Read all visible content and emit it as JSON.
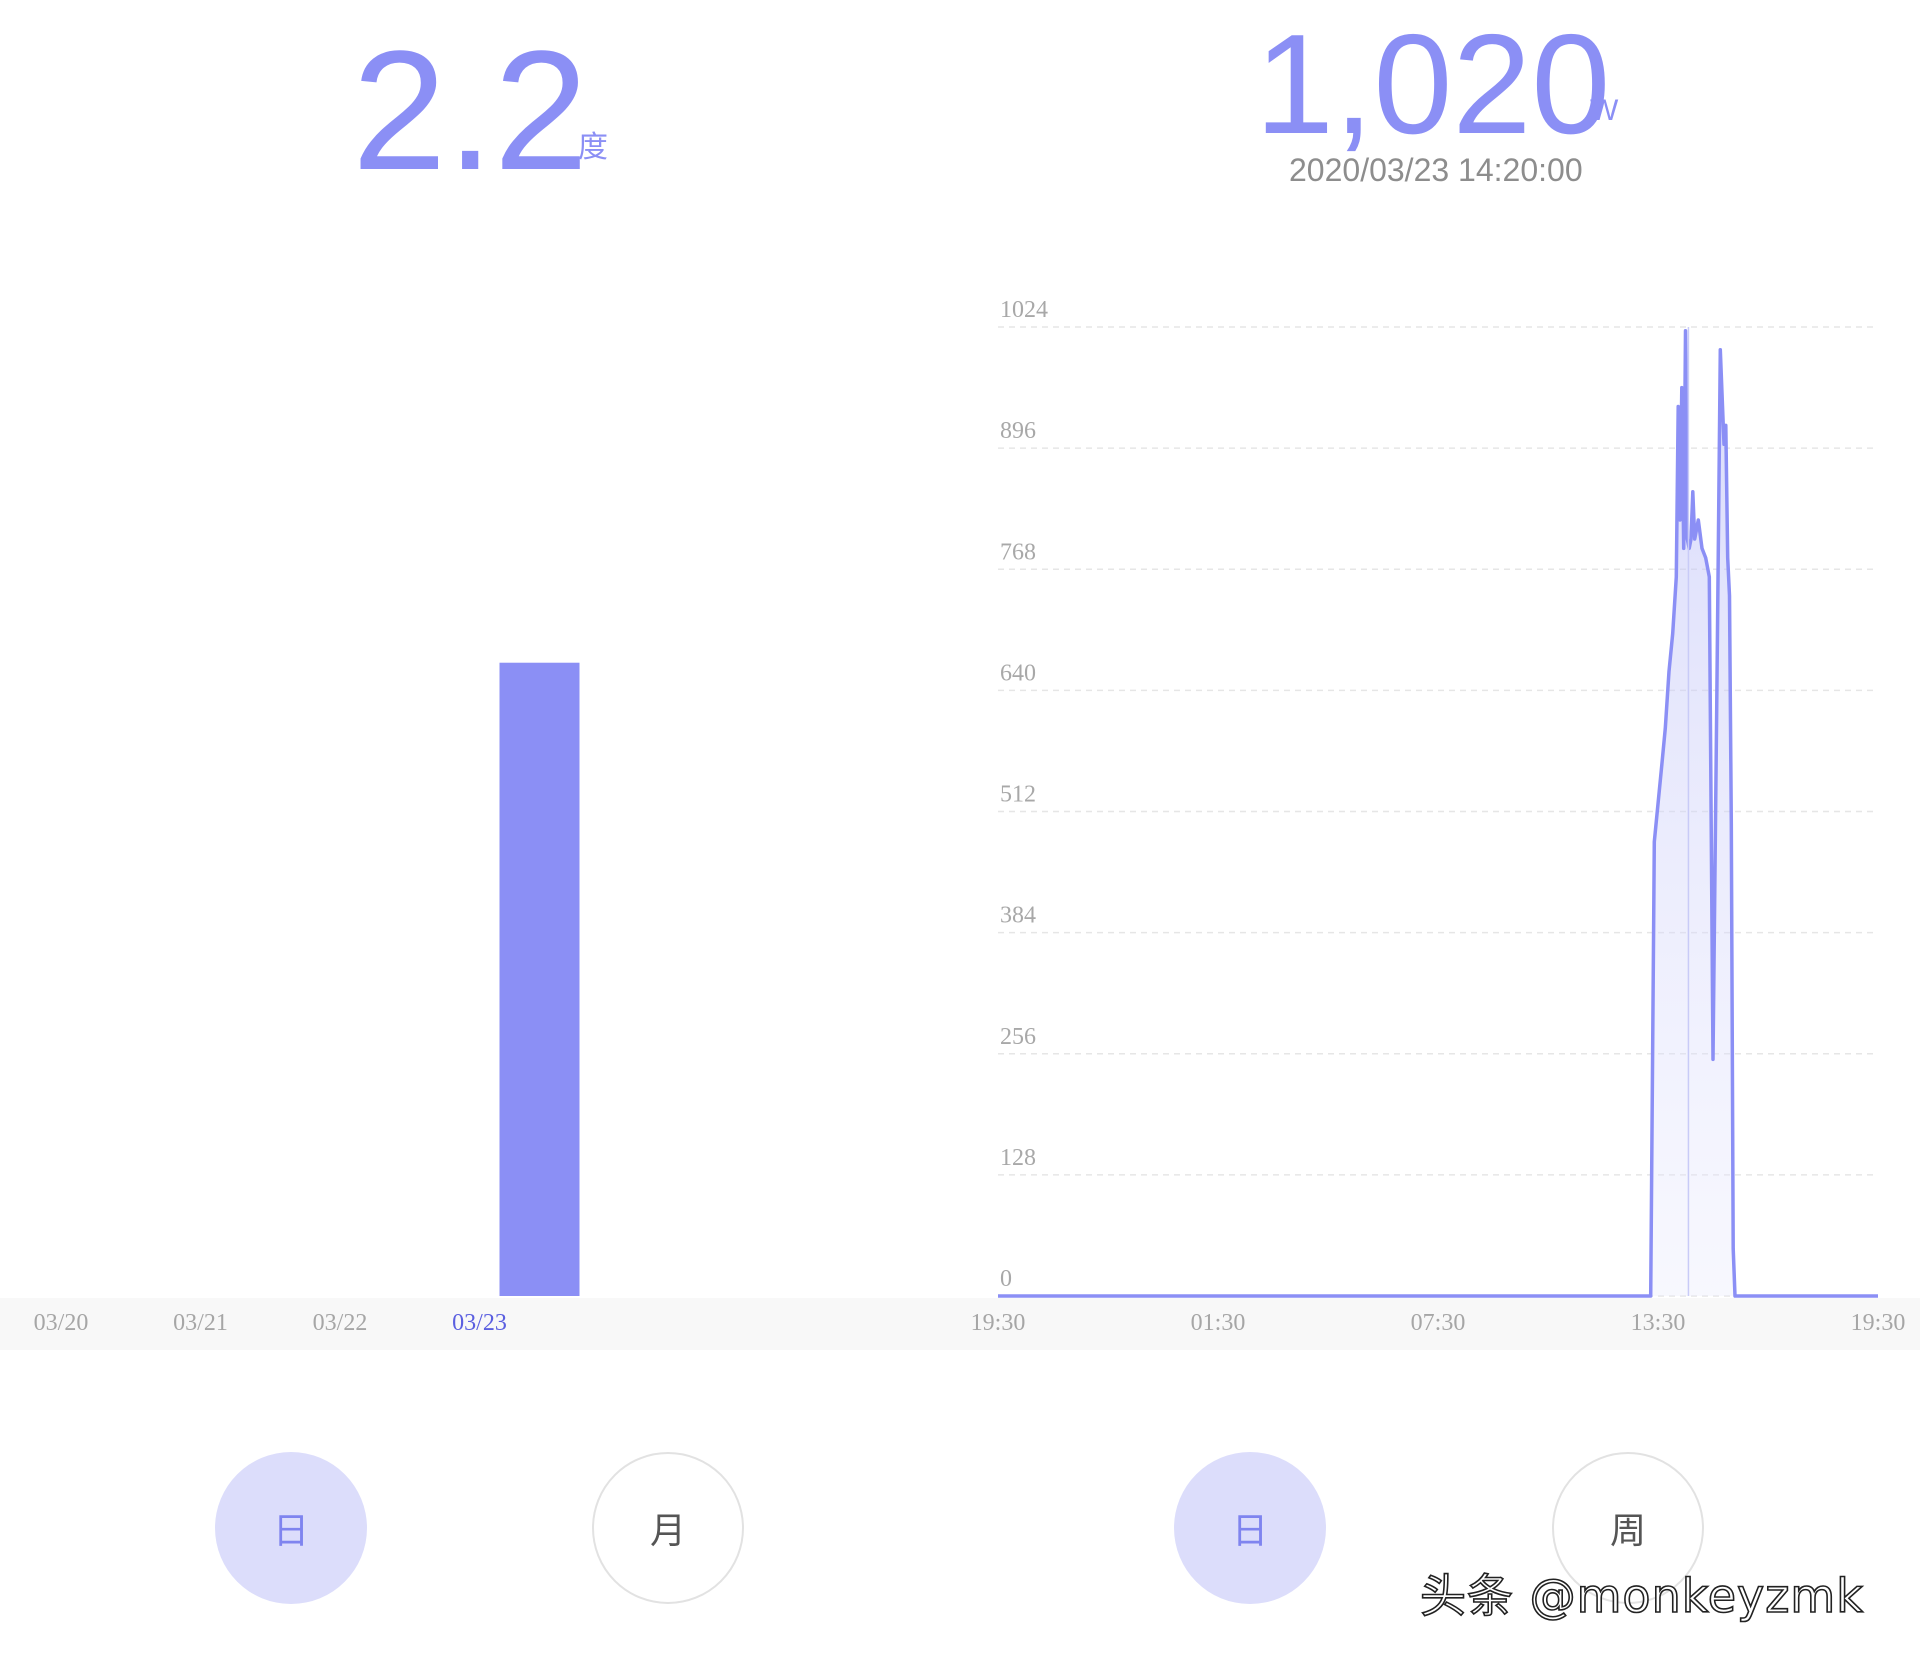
{
  "energy": {
    "value": "2.2",
    "unit": "度",
    "tab_day": "日",
    "tab_month": "月"
  },
  "power": {
    "value": "1,020",
    "unit": "W",
    "timestamp": "2020/03/23 14:20:00",
    "tab_day": "日",
    "tab_week": "周"
  },
  "watermark": "头条 @monkeyzmk",
  "colors": {
    "accent": "#8b8ff5",
    "accent_light": "#dcddfb",
    "active_tick": "#5b5fe0"
  },
  "chart_data": [
    {
      "type": "bar",
      "categories": [
        "03/20",
        "03/21",
        "03/22",
        "03/23"
      ],
      "values": [
        0,
        0,
        0,
        2.2
      ],
      "active_category": "03/23",
      "ylim": [
        0,
        2.8
      ]
    },
    {
      "type": "area",
      "x_ticks": [
        "19:30",
        "01:30",
        "07:30",
        "13:30",
        "19:30"
      ],
      "y_ticks": [
        0,
        128,
        256,
        384,
        512,
        640,
        768,
        896,
        1024
      ],
      "ylim": [
        0,
        1024
      ],
      "xlim_hours": [
        0,
        24
      ],
      "grid": true,
      "x_hours_since_start": [
        0,
        17.8,
        17.9,
        18.0,
        18.1,
        18.2,
        18.3,
        18.4,
        18.5,
        18.55,
        18.6,
        18.65,
        18.7,
        18.75,
        18.8,
        18.85,
        18.9,
        18.95,
        19.0,
        19.1,
        19.2,
        19.3,
        19.4,
        19.5,
        19.6,
        19.7,
        19.8,
        19.85,
        19.9,
        19.95,
        20.0,
        20.05,
        20.1,
        20.15,
        20.2,
        20.25,
        20.3,
        24
      ],
      "values": [
        0,
        0,
        480,
        520,
        560,
        600,
        660,
        700,
        760,
        940,
        820,
        960,
        790,
        1020,
        800,
        790,
        800,
        850,
        800,
        820,
        790,
        780,
        760,
        250,
        620,
        1000,
        900,
        920,
        780,
        740,
        500,
        50,
        0,
        0,
        0,
        0,
        0,
        0
      ]
    }
  ]
}
